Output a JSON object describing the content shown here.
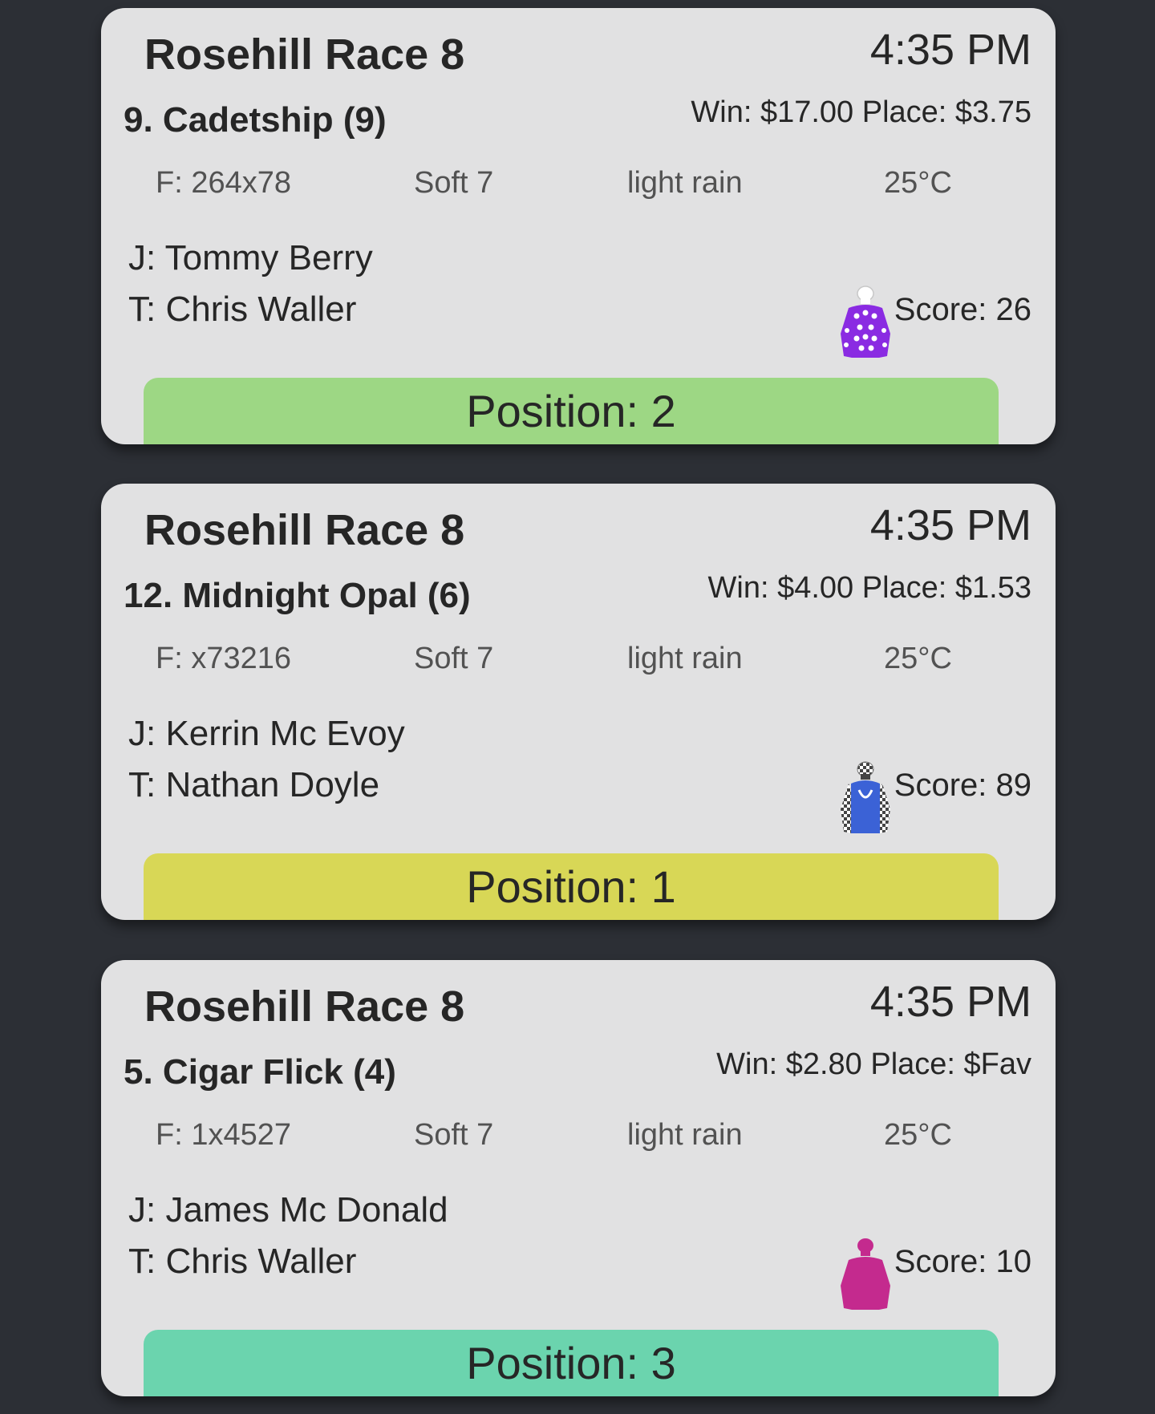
{
  "cards": [
    {
      "venue": "Rosehill Race 8",
      "time": "4:35 PM",
      "runner": "9. Cadetship (9)",
      "odds": "Win: $17.00 Place: $3.75",
      "form": "F: 264x78",
      "track": "Soft 7",
      "weather": "light rain",
      "temperature": "25°C",
      "jockey": "J: Tommy Berry",
      "trainer": "T: Chris Waller",
      "score": "Score: 26",
      "position": "Position: 2",
      "position_color": "#9dd784",
      "silk_icon": "purple-stars-silk-icon"
    },
    {
      "venue": "Rosehill Race 8",
      "time": "4:35 PM",
      "runner": "12. Midnight Opal (6)",
      "odds": "Win: $4.00 Place: $1.53",
      "form": "F: x73216",
      "track": "Soft 7",
      "weather": "light rain",
      "temperature": "25°C",
      "jockey": "J: Kerrin Mc Evoy",
      "trainer": "T: Nathan Doyle",
      "score": "Score: 89",
      "position": "Position: 1",
      "position_color": "#d8d756",
      "silk_icon": "blue-checked-sleeves-silk-icon"
    },
    {
      "venue": "Rosehill Race 8",
      "time": "4:35 PM",
      "runner": "5. Cigar Flick (4)",
      "odds": "Win: $2.80 Place: $Fav",
      "form": "F: 1x4527",
      "track": "Soft 7",
      "weather": "light rain",
      "temperature": "25°C",
      "jockey": "J: James Mc Donald",
      "trainer": "T: Chris Waller",
      "score": "Score: 10",
      "position": "Position: 3",
      "position_color": "#6bd4ae",
      "silk_icon": "magenta-silk-icon"
    }
  ]
}
